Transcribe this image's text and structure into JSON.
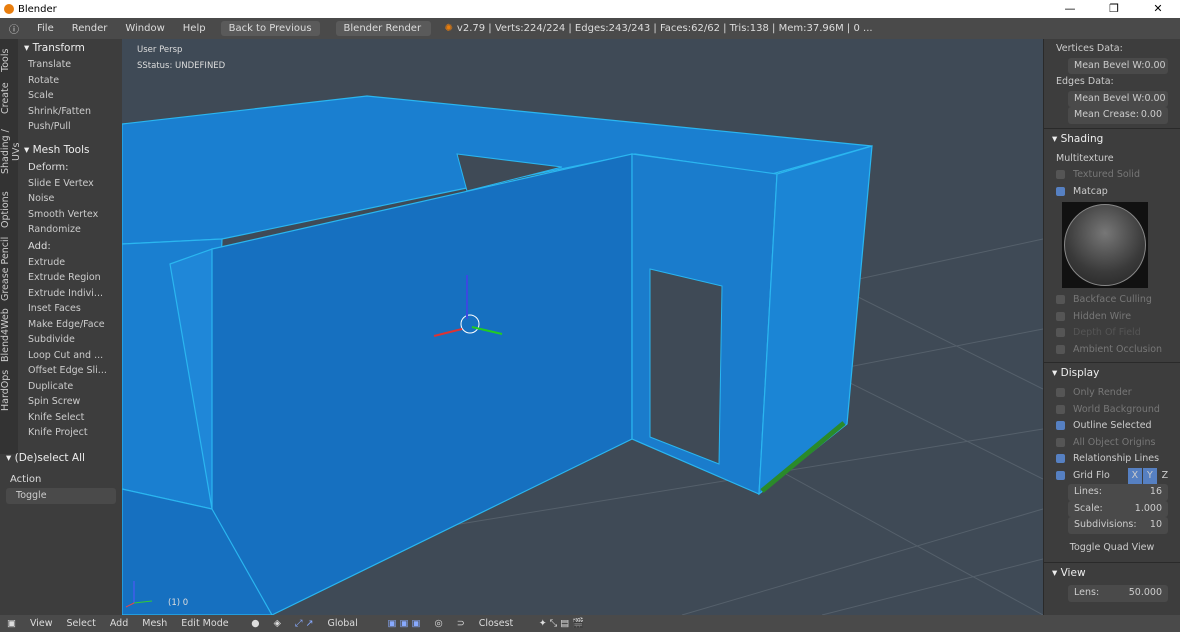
{
  "window": {
    "title": "Blender",
    "controls": [
      "—",
      "❐",
      "✕"
    ]
  },
  "menu": {
    "items": [
      "File",
      "Render",
      "Window",
      "Help"
    ],
    "back": "Back to Previous",
    "engine": "Blender Render",
    "stats": "v2.79 | Verts:224/224 | Edges:243/243 | Faces:62/62 | Tris:138 | Mem:37.96M | 0 ..."
  },
  "left_tabs": [
    "Tools",
    "Create",
    "Shading / UVs",
    "Options",
    "Grease Pencil",
    "Blend4Web",
    "HardOps"
  ],
  "transform": {
    "title": "Transform",
    "items": [
      "Translate",
      "Rotate",
      "Scale",
      "Shrink/Fatten",
      "Push/Pull"
    ]
  },
  "mesh_tools": {
    "title": "Mesh Tools",
    "deform": "Deform:",
    "deform_items": [
      "Slide E    Vertex",
      "Noise",
      "Smooth Vertex",
      "Randomize"
    ],
    "add": "Add:",
    "add_items": [
      "Extrude",
      "Extrude Region",
      "Extrude Indivi...",
      "Inset Faces",
      "Make Edge/Face",
      "Subdivide",
      "Loop Cut and ...",
      "Offset Edge Sli...",
      "Duplicate",
      "Spin      Screw",
      "Knife      Select",
      "Knife Project"
    ]
  },
  "operator": {
    "title": "(De)select All",
    "action": "Action",
    "value": "Toggle"
  },
  "viewport": {
    "view": "User Persp",
    "status": "SStatus: UNDEFINED",
    "object": "(1) 0"
  },
  "right": {
    "vertices_data": "Vertices Data:",
    "mean_bevel_v": {
      "label": "Mean Bevel W:",
      "value": "0.00"
    },
    "edges_data": "Edges Data:",
    "mean_bevel_e": {
      "label": "Mean Bevel W:",
      "value": "0.00"
    },
    "mean_crease": {
      "label": "Mean Crease:",
      "value": "0.00"
    },
    "shading": {
      "title": "Shading",
      "mode": "Multitexture",
      "textured_solid": "Textured Solid",
      "matcap": "Matcap",
      "backface": "Backface Culling",
      "hidden_wire": "Hidden Wire",
      "dof": "Depth Of Field",
      "ao": "Ambient Occlusion"
    },
    "display": {
      "title": "Display",
      "only_render": "Only Render",
      "world_bg": "World Background",
      "outline": "Outline Selected",
      "all_origins": "All Object Origins",
      "rel_lines": "Relationship Lines",
      "grid": "Grid Flo",
      "axes": [
        "X",
        "Y",
        "Z"
      ],
      "lines": {
        "label": "Lines:",
        "value": "16"
      },
      "scale": {
        "label": "Scale:",
        "value": "1.000"
      },
      "subdivisions": {
        "label": "Subdivisions:",
        "value": "10"
      },
      "quad": "Toggle Quad View"
    },
    "view": {
      "title": "View",
      "lens": {
        "label": "Lens:",
        "value": "50.000"
      }
    }
  },
  "bottom": {
    "items": [
      "View",
      "Select",
      "Add",
      "Mesh"
    ],
    "mode": "Edit Mode",
    "orientation": "Global",
    "snap": "Closest"
  }
}
